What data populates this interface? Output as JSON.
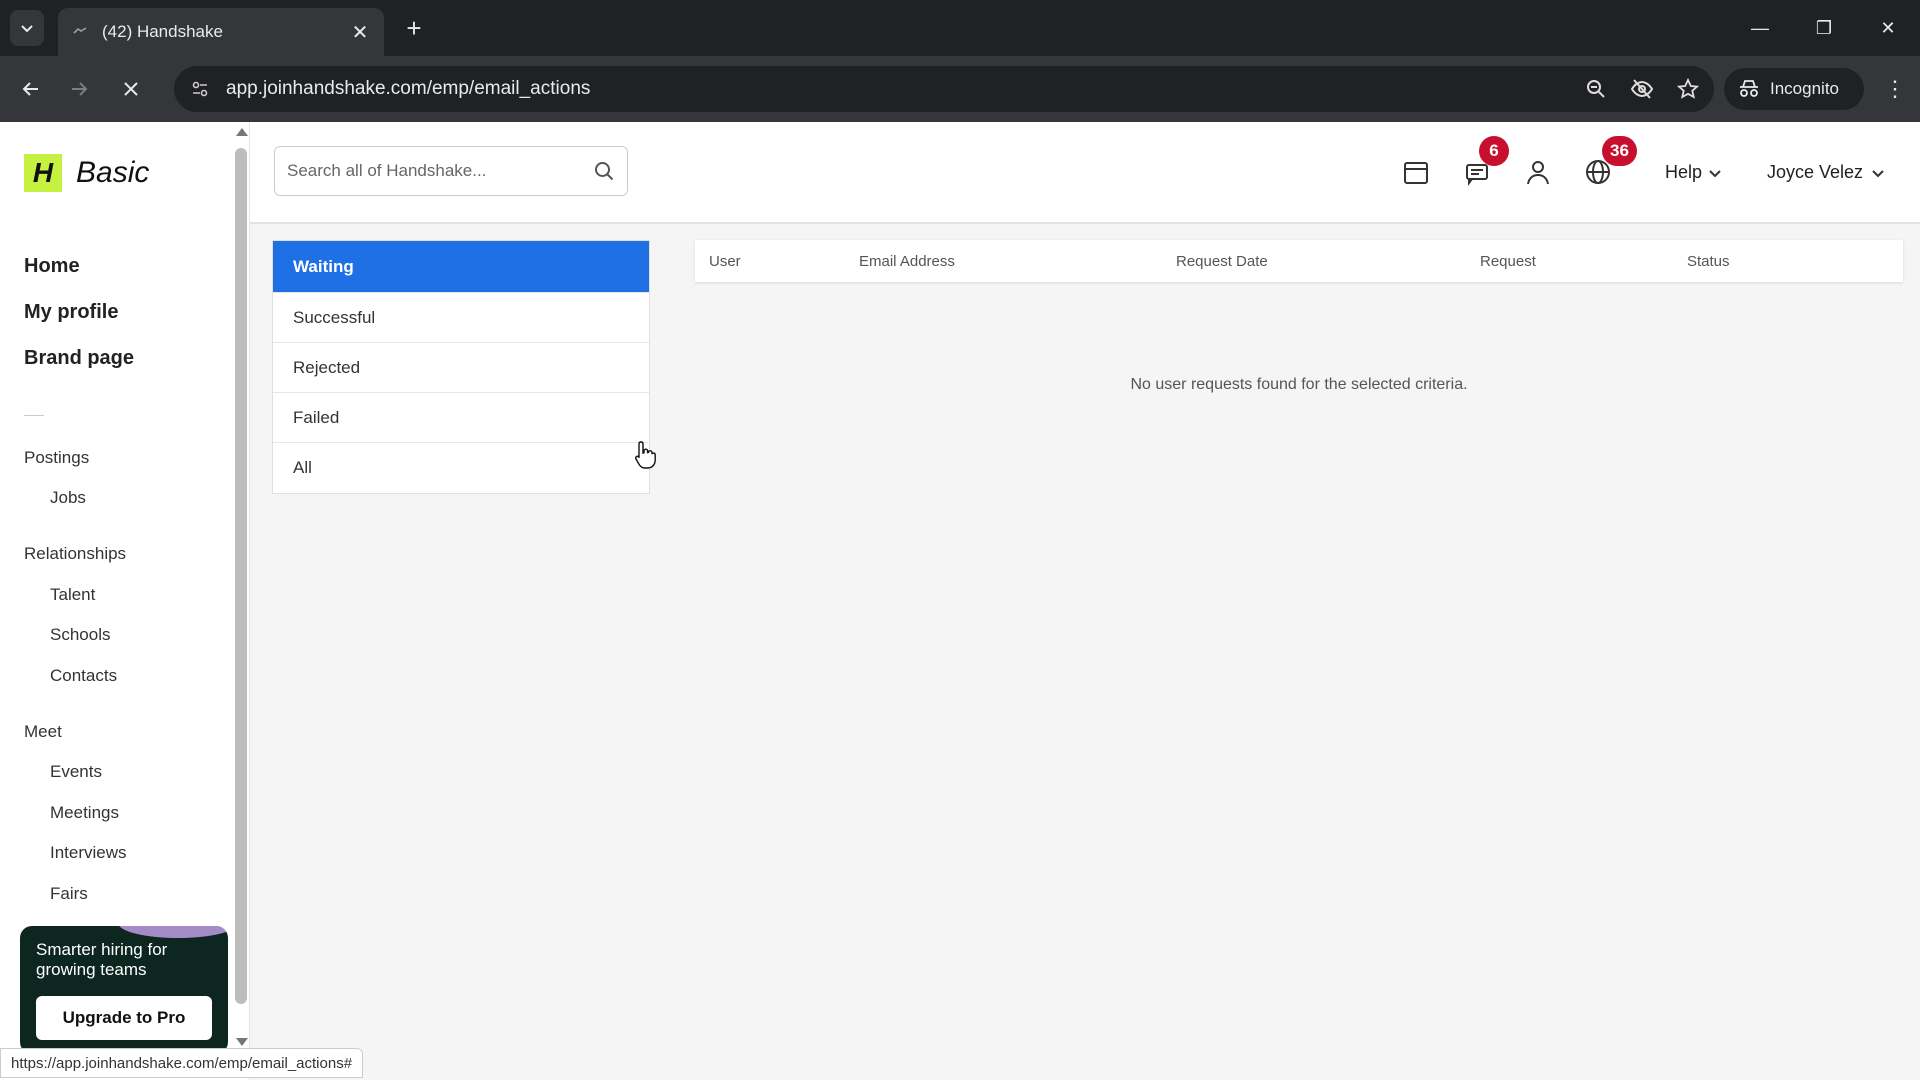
{
  "browser": {
    "tab_title": "(42) Handshake",
    "url": "app.joinhandshake.com/emp/email_actions",
    "incognito_label": "Incognito",
    "status_url": "https://app.joinhandshake.com/emp/email_actions#"
  },
  "sidebar": {
    "logo_text": "Basic",
    "main_nav": [
      "Home",
      "My profile",
      "Brand page"
    ],
    "sections": {
      "postings": "Postings",
      "jobs": "Jobs",
      "relationships": "Relationships",
      "talent": "Talent",
      "schools": "Schools",
      "contacts": "Contacts",
      "meet": "Meet",
      "events": "Events",
      "meetings": "Meetings",
      "interviews": "Interviews",
      "fairs": "Fairs"
    },
    "promo": {
      "text": "Smarter hiring for growing teams",
      "button": "Upgrade to Pro"
    }
  },
  "header": {
    "search_placeholder": "Search all of Handshake...",
    "messages_badge": "6",
    "notifications_badge": "36",
    "help_label": "Help",
    "user_name": "Joyce Velez"
  },
  "filters": [
    "Waiting",
    "Successful",
    "Rejected",
    "Failed",
    "All"
  ],
  "active_filter": "Waiting",
  "table": {
    "columns": [
      "User",
      "Email Address",
      "Request Date",
      "Request",
      "Status"
    ],
    "empty_message": "No user requests found for the selected criteria."
  },
  "colors": {
    "accent": "#1f6fe5",
    "badge": "#c8102e",
    "logo": "#c7f141",
    "promo_bg": "#0d2620"
  }
}
